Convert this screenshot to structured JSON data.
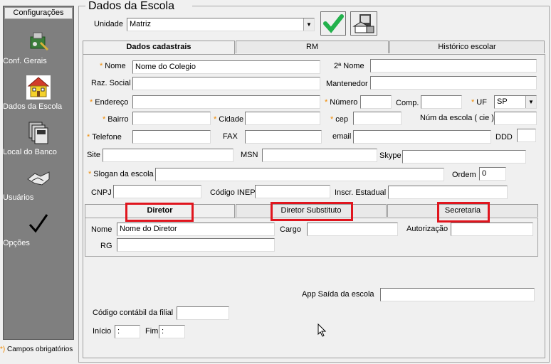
{
  "sidebar": {
    "header": "Configurações",
    "items": [
      {
        "label": "Conf. Gerais",
        "icon": "settings-tools-icon"
      },
      {
        "label": "Dados da Escola",
        "icon": "school-icon"
      },
      {
        "label": "Local do Banco",
        "icon": "database-icon"
      },
      {
        "label": "Usuários",
        "icon": "users-handshake-icon"
      },
      {
        "label": "Opções",
        "icon": "checkmark-icon"
      }
    ],
    "required_note": "Campos obrigatórios"
  },
  "main": {
    "title": "Dados da Escola",
    "unidade_label": "Unidade",
    "unidade_value": "Matriz",
    "tabs": [
      "Dados cadastrais",
      "RM",
      "Histórico escolar"
    ],
    "fields": {
      "nome_label": "Nome",
      "nome_value": "Nome do Colegio",
      "nome2_label": "2ª Nome",
      "razao_label": "Raz. Social",
      "mantenedor_label": "Mantenedor",
      "endereco_label": "Endereço",
      "numero_label": "Número",
      "comp_label": "Comp.",
      "uf_label": "UF",
      "uf_value": "SP",
      "bairro_label": "Bairro",
      "cidade_label": "Cidade",
      "cep_label": "cep",
      "num_escola_label": "Núm da escola ( cie )",
      "telefone_label": "Telefone",
      "fax_label": "FAX",
      "email_label": "email",
      "ddd_label": "DDD",
      "site_label": "Site",
      "msn_label": "MSN",
      "skype_label": "Skype",
      "slogan_label": "Slogan da escola",
      "ordem_label": "Ordem",
      "ordem_value": "0",
      "cnpj_label": "CNPJ",
      "inep_label": "Código INEP",
      "inscr_label": "Inscr. Estadual"
    },
    "subtabs": [
      "Diretor",
      "Diretor Substituto",
      "Secretaria"
    ],
    "diretor": {
      "nome_label": "Nome",
      "nome_value": "Nome do Diretor",
      "cargo_label": "Cargo",
      "autorizacao_label": "Autorização",
      "rg_label": "RG"
    },
    "bottom": {
      "app_saida_label": "App Saída da escola",
      "codigo_contabil_label": "Código contábil da filial",
      "inicio_label": "Início",
      "inicio_value": ":",
      "fim_label": "Fim",
      "fim_value": ":"
    }
  },
  "colors": {
    "accent_green": "#22b14c",
    "required_star": "#f08a00",
    "highlight_red": "#e0151e"
  }
}
